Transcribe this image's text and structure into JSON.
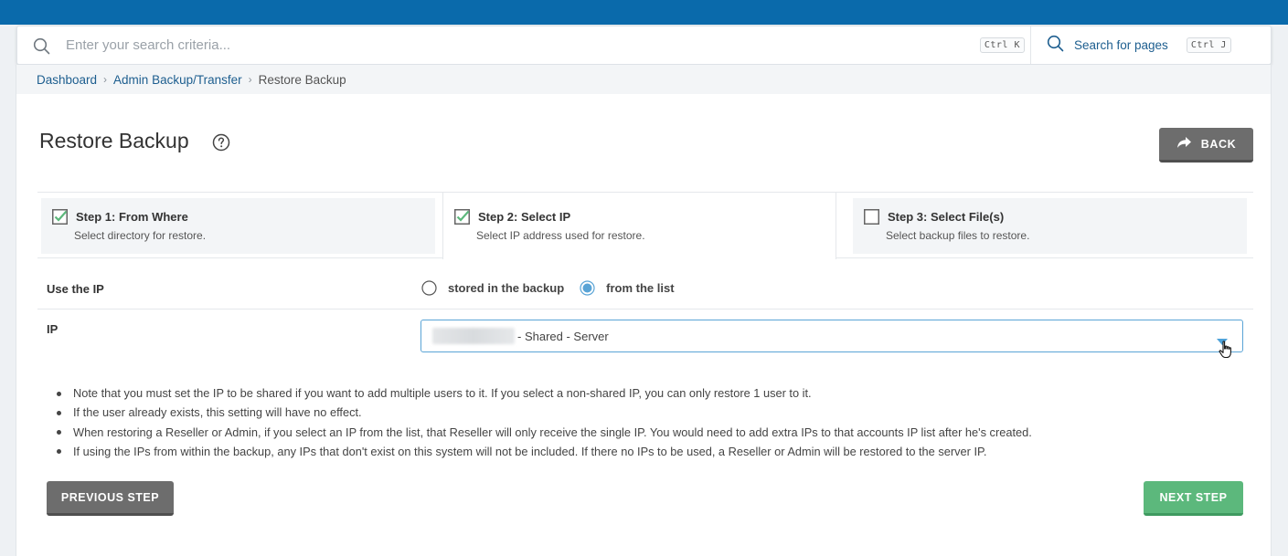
{
  "search": {
    "placeholder": "Enter your search criteria...",
    "shortcut": "Ctrl K",
    "pages_label": "Search for pages",
    "pages_shortcut": "Ctrl J"
  },
  "breadcrumb": {
    "items": [
      "Dashboard",
      "Admin Backup/Transfer"
    ],
    "current": "Restore Backup"
  },
  "page": {
    "title": "Restore Backup",
    "back_label": "BACK"
  },
  "steps": [
    {
      "title": "Step 1: From Where",
      "desc": "Select directory for restore.",
      "checked": true
    },
    {
      "title": "Step 2: Select IP",
      "desc": "Select IP address used for restore.",
      "checked": true
    },
    {
      "title": "Step 3: Select File(s)",
      "desc": "Select backup files to restore.",
      "checked": false
    }
  ],
  "use_ip": {
    "label": "Use the IP",
    "options": [
      "stored in the backup",
      "from the list"
    ],
    "selected": "from the list"
  },
  "ip": {
    "label": "IP",
    "value": "- Shared - Server"
  },
  "notes": [
    "Note that you must set the IP to be shared if you want to add multiple users to it. If you select a non-shared IP, you can only restore 1 user to it.",
    "If the user already exists, this setting will have no effect.",
    "When restoring a Reseller or Admin, if you select an IP from the list, that Reseller will only receive the single IP. You would need to add extra IPs to that accounts IP list after he's created.",
    "If using the IPs from within the backup, any IPs that don't exist on this system will not be included. If there no IPs to be used, a Reseller or Admin will be restored to the server IP."
  ],
  "buttons": {
    "previous": "PREVIOUS STEP",
    "next": "NEXT STEP"
  },
  "colors": {
    "header": "#0a6aab",
    "link": "#1d5e8f",
    "check": "#5cb87c",
    "radio": "#5aa4d6",
    "next": "#5cb87c",
    "gray_button": "#6d6d6d"
  }
}
